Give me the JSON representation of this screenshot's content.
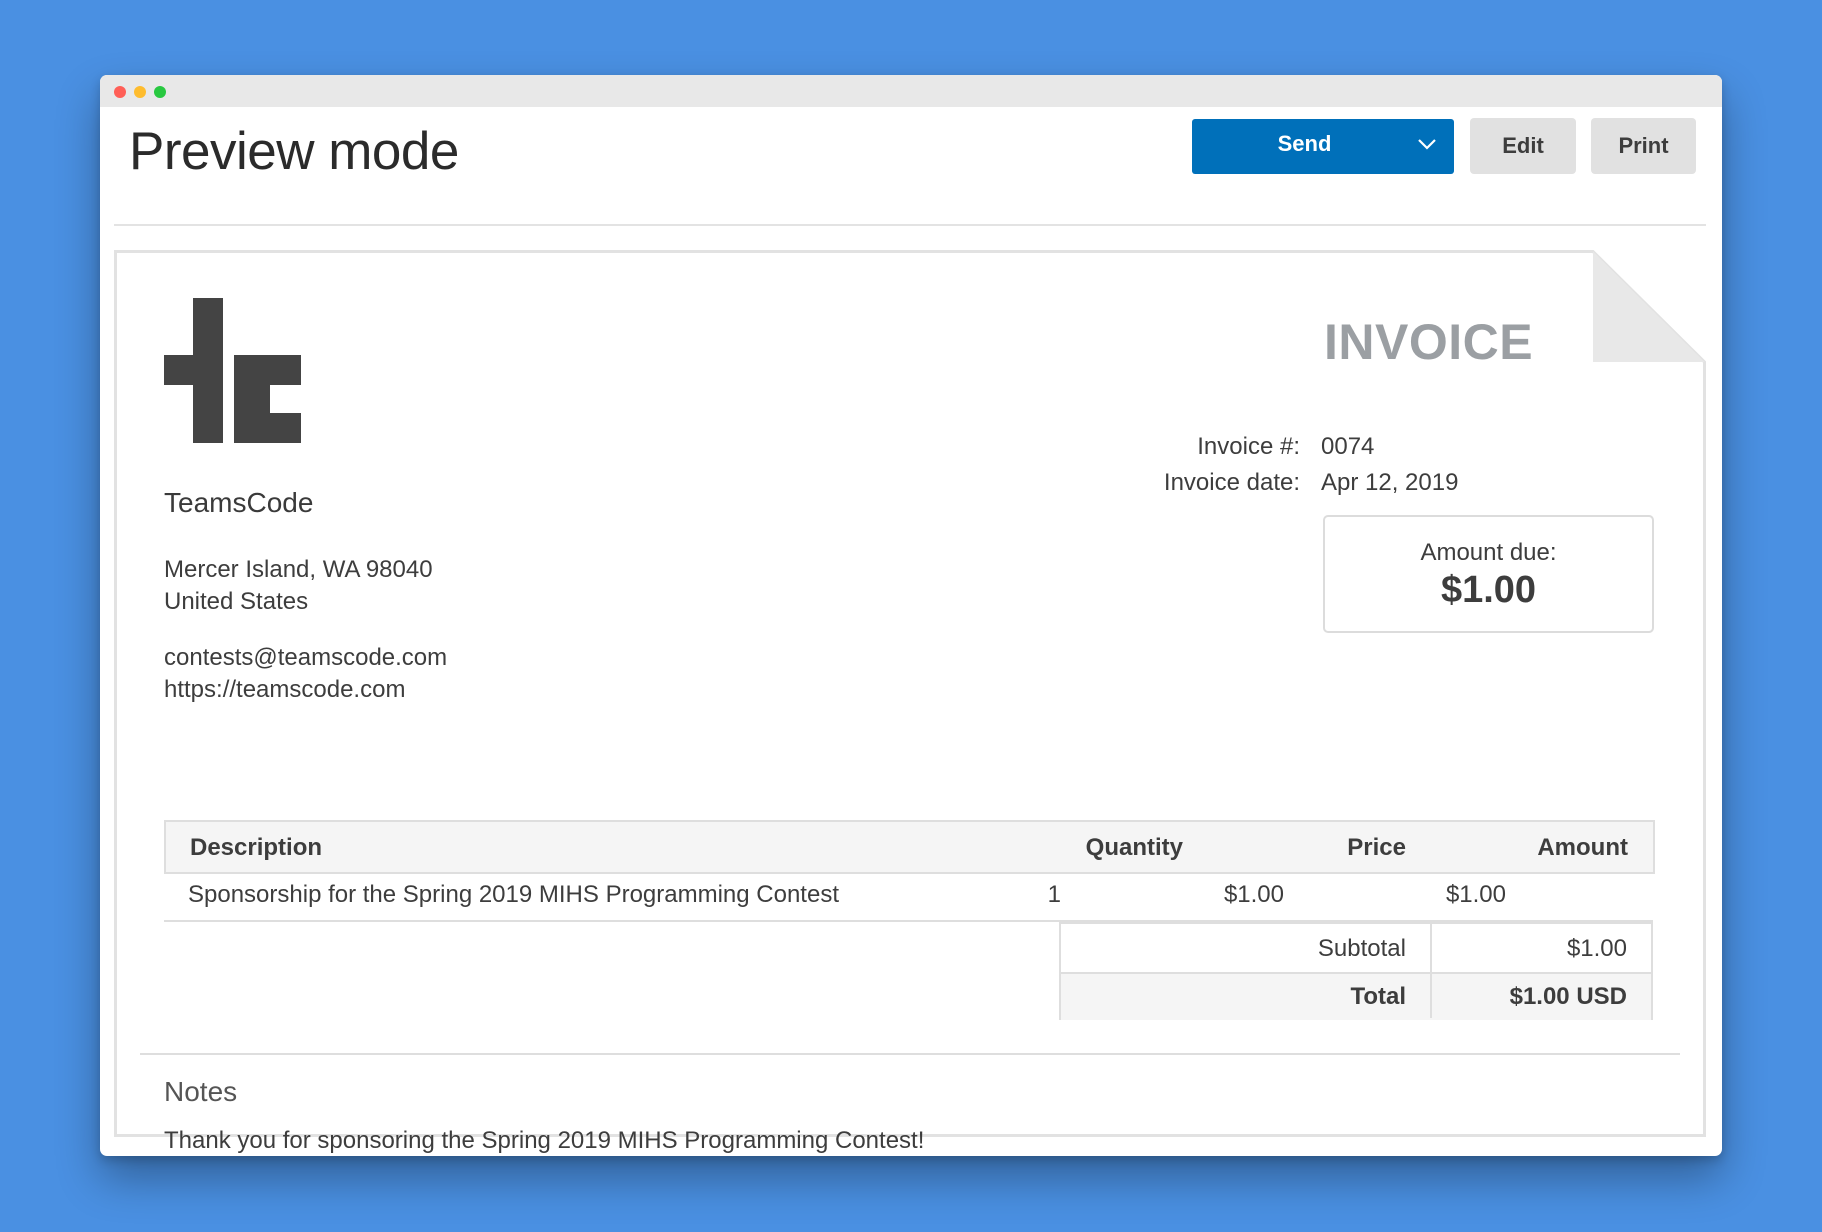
{
  "header": {
    "title": "Preview mode",
    "send_label": "Send",
    "edit_label": "Edit",
    "print_label": "Print"
  },
  "invoice": {
    "heading": "INVOICE",
    "company": {
      "name": "TeamsCode",
      "address_line1": "Mercer Island, WA 98040",
      "address_line2": "United States",
      "email": "contests@teamscode.com",
      "website": "https://teamscode.com"
    },
    "meta": {
      "number_label": "Invoice #:",
      "number_value": "0074",
      "date_label": "Invoice date:",
      "date_value": "Apr 12, 2019"
    },
    "amount_due": {
      "label": "Amount due:",
      "value": "$1.00"
    },
    "table": {
      "headers": {
        "description": "Description",
        "quantity": "Quantity",
        "price": "Price",
        "amount": "Amount"
      },
      "rows": [
        {
          "description": "Sponsorship for the Spring 2019 MIHS Programming Contest",
          "quantity": "1",
          "price": "$1.00",
          "amount": "$1.00"
        }
      ],
      "subtotal_label": "Subtotal",
      "subtotal_value": "$1.00",
      "total_label": "Total",
      "total_value": "$1.00 USD"
    },
    "notes": {
      "title": "Notes",
      "text": "Thank you for sponsoring the Spring 2019 MIHS Programming Contest!"
    }
  },
  "colors": {
    "background": "#4a90e2",
    "primary_button": "#0070ba",
    "secondary_button": "#e1e1e1",
    "invoice_heading": "#9b9fa3"
  }
}
